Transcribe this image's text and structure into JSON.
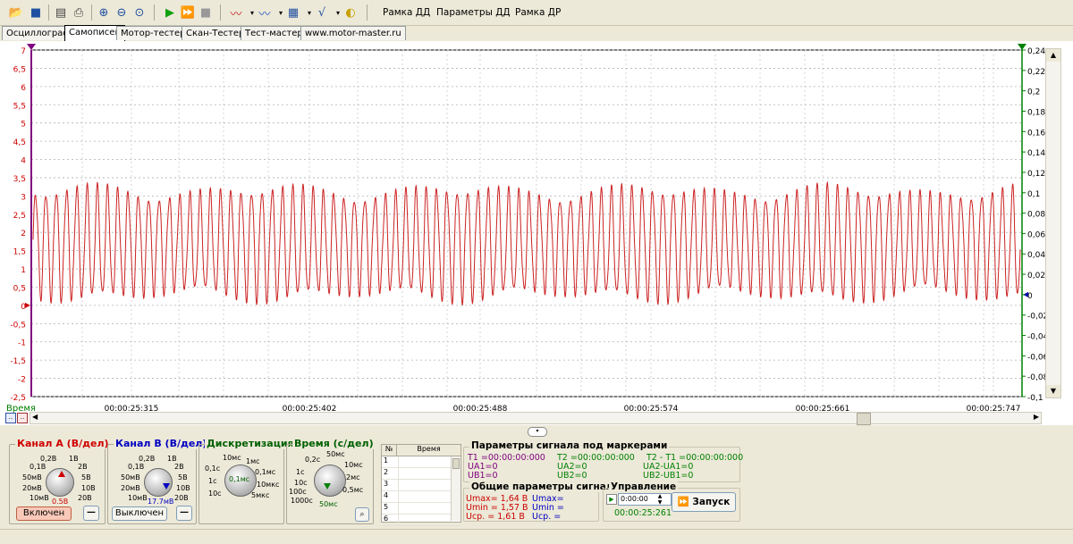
{
  "toolbar": {
    "frame_dd": "Рамка ДД",
    "params_dd": "Параметры ДД",
    "frame_dr": "Рамка ДР"
  },
  "tabs": [
    {
      "label": "Осциллограф"
    },
    {
      "label": "Самописец"
    },
    {
      "label": "Мотор-тестер"
    },
    {
      "label": "Скан-Тестер"
    },
    {
      "label": "Тест-мастер"
    },
    {
      "label": "www.motor-master.ru"
    }
  ],
  "chart_data": {
    "type": "line",
    "left_axis": {
      "min": -2.5,
      "max": 7,
      "ticks": [
        "7",
        "6,5",
        "6",
        "5,5",
        "5",
        "4,5",
        "4",
        "3,5",
        "3",
        "2,5",
        "2",
        "1,5",
        "1",
        "0,5",
        "0",
        "-0,5",
        "-1",
        "-1,5",
        "-2",
        "-2,5"
      ],
      "color": "#cc0000"
    },
    "right_axis": {
      "min": -0.1,
      "max": 0.24,
      "ticks": [
        "0,24",
        "0,22",
        "0,2",
        "0,18",
        "0,16",
        "0,14",
        "0,12",
        "0,1",
        "0,08",
        "0,06",
        "0,04",
        "0,02",
        "0",
        "-0,02",
        "-0,04",
        "-0,06",
        "-0,08",
        "-0,1"
      ],
      "color": "#008000"
    },
    "x_axis_label": "Время",
    "x_ticks": [
      "00:00:25:315",
      "00:00:25:402",
      "00:00:25:488",
      "00:00:25:574",
      "00:00:25:661",
      "00:00:25:747"
    ],
    "series": [
      {
        "color": "#cc2222",
        "cycles": 96,
        "center": 1.7,
        "amplitude": 1.4,
        "min": 0.2,
        "max": 3.2
      }
    ]
  },
  "channel_a": {
    "title": "Канал А (В/дел)",
    "labels": [
      "0,2В",
      "1В",
      "0,1В",
      "2В",
      "50мВ",
      "5В",
      "20мВ",
      "10В",
      "10мВ",
      "20В"
    ],
    "value": "0.5В",
    "button": "Включен"
  },
  "channel_b": {
    "title": "Канал В (В/дел)",
    "labels": [
      "0,2В",
      "1В",
      "0,1В",
      "2В",
      "50мВ",
      "5В",
      "20мВ",
      "10В",
      "10мВ",
      "20В"
    ],
    "value": "17.7мВ",
    "button": "Выключен"
  },
  "discretization": {
    "title": "Дискретизация",
    "labels": [
      "10мс",
      "1мс",
      "0,1с",
      "0,1мс",
      "1с",
      "10мкс",
      "10с",
      "5мкс"
    ],
    "value": "0,1мс"
  },
  "time": {
    "title": "Время (с/дел)",
    "labels": [
      "0,2с",
      "50мс",
      "1с",
      "10мс",
      "10с",
      "2мс",
      "100с",
      "0,5мс",
      "1000с"
    ],
    "value": "50мс"
  },
  "table": {
    "headers": [
      "№",
      "Время"
    ],
    "rows": [
      "1",
      "2",
      "3",
      "4",
      "5",
      "6"
    ]
  },
  "marker_params": {
    "title": "Параметры сигнала под маркерами",
    "t1": "T1 =00:00:00:000",
    "ua1": "UA1=0",
    "ub1": "UB1=0",
    "t2": "T2 =00:00:00:000",
    "ua2": "UA2=0",
    "ub2": "UB2=0",
    "dt": "T2 - T1 =00:00:00:000",
    "dua": "UA2-UA1=0",
    "dub": "UB2-UB1=0"
  },
  "general_params": {
    "title": "Общие параметры сигнала",
    "umax_a": "Umax= 1,64 В",
    "umin_a": "Umin = 1,57 В",
    "uavg_a": "Ucp. = 1,61 В",
    "umax_b": "Umax=",
    "umin_b": "Umin =",
    "uavg_b": "Ucp. ="
  },
  "control": {
    "title": "Управление",
    "time_value": "0:00:00",
    "elapsed": "00:00:25:261",
    "start_label": "Запуск"
  }
}
